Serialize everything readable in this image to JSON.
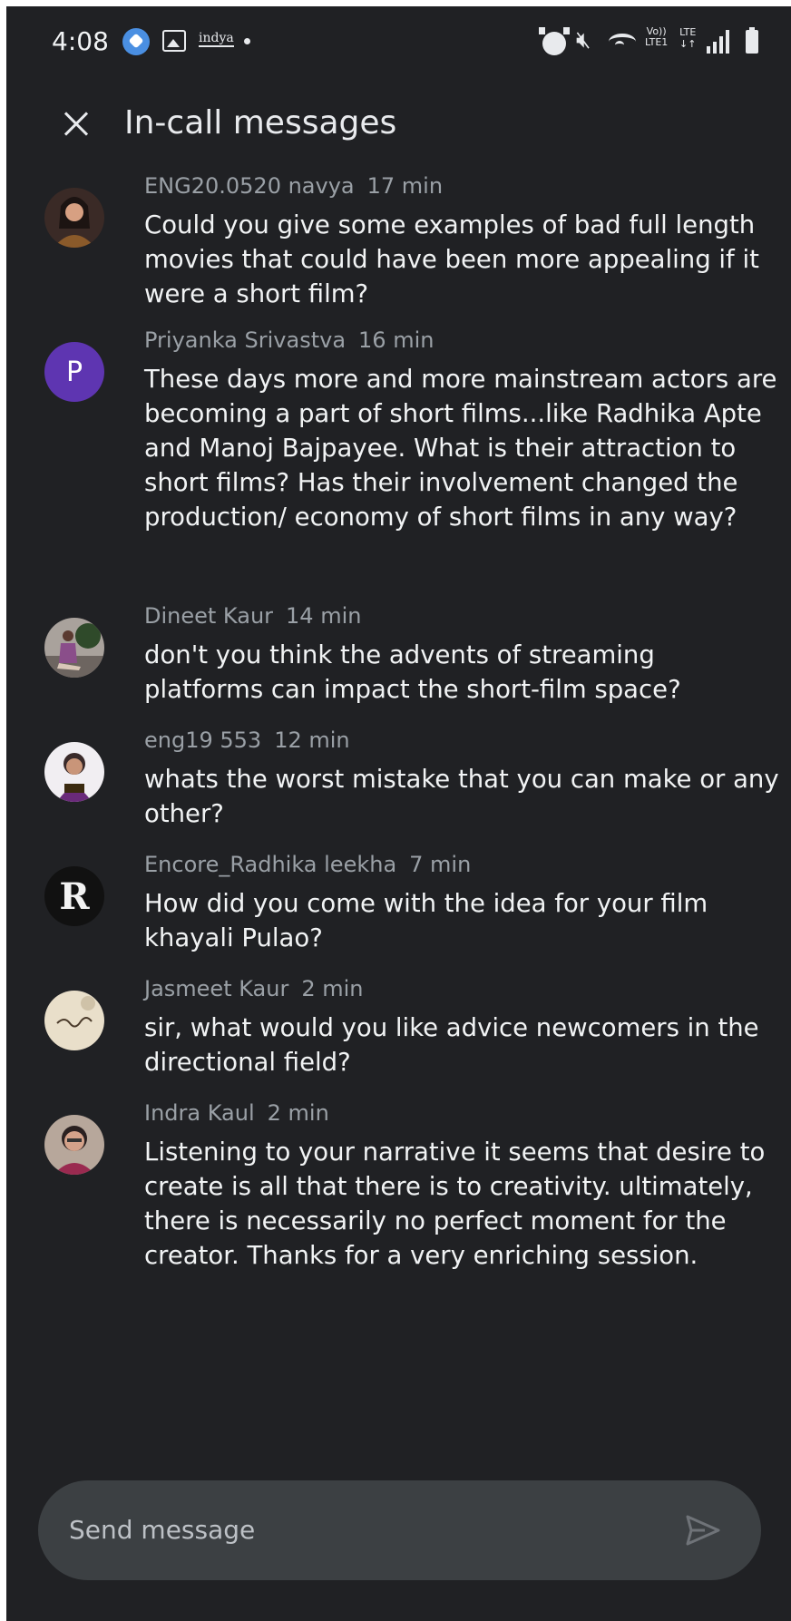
{
  "status_bar": {
    "time": "4:08",
    "indya_label": "indya",
    "volte_line1": "Vo))",
    "volte_line2": "LTE1",
    "lte_line1": "LTE",
    "lte_line2": "↓↑"
  },
  "header": {
    "title": "In-call messages"
  },
  "messages": [
    {
      "sender": "ENG20.0520 navya",
      "time": "17 min",
      "text": "Could you give some examples of bad full length movies that could have been more appealing if it were a short film?",
      "avatar": "photo",
      "avatar_color": "#5a3a2e"
    },
    {
      "sender": "Priyanka Srivastva",
      "time": "16 min",
      "text": "These days more and more mainstream actors are becoming a part of short films...like Radhika Apte and Manoj Bajpayee. What is their attraction to short films? Has their involvement changed the production/ economy of short films in any way?",
      "avatar": "initial",
      "avatar_initial": "P",
      "avatar_color": "#5e35b1"
    },
    {
      "sender": "Dineet Kaur",
      "time": "14 min",
      "text": "don't you think the advents of streaming platforms can impact the short-film space?",
      "avatar": "photo",
      "avatar_color": "#7a6b66"
    },
    {
      "sender": "eng19 553",
      "time": "12 min",
      "text": "whats the worst mistake that you can make or any other?",
      "avatar": "photo",
      "avatar_color": "#c4b8c8"
    },
    {
      "sender": "Encore_Radhika leekha",
      "time": "7 min",
      "text": "How did you come with the idea for your film khayali Pulao?",
      "avatar": "logo",
      "avatar_initial": "R",
      "avatar_color": "#111111"
    },
    {
      "sender": "Jasmeet Kaur",
      "time": "2 min",
      "text": "sir, what would you like advice newcomers in the directional field?",
      "avatar": "logo",
      "avatar_color": "#e9dfca"
    },
    {
      "sender": "Indra Kaul",
      "time": "2 min",
      "text": "Listening to your narrative it seems that desire to create is all that there is to creativity. ultimately, there is necessarily no perfect moment for the creator. Thanks for a very enriching session.",
      "avatar": "photo",
      "avatar_color": "#b7a79b"
    }
  ],
  "composer": {
    "placeholder": "Send message"
  },
  "colors": {
    "background": "#202124",
    "composer": "#3c4043",
    "primary_text": "#f1f3f4",
    "secondary_text": "#9aa0a6",
    "accent": "#5e35b1"
  },
  "icons": [
    "close-icon",
    "send-icon",
    "alarm-icon",
    "mute-icon",
    "wifi-icon",
    "signal-icon",
    "battery-icon",
    "gallery-icon"
  ]
}
